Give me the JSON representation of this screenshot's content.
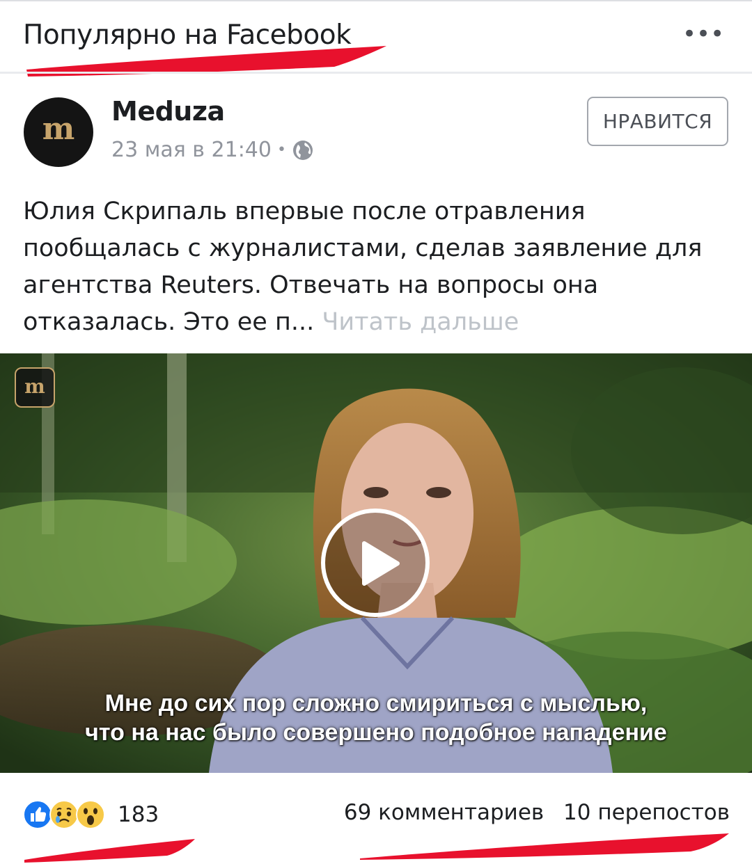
{
  "header": {
    "title": "Популярно на Facebook",
    "more_label": "•••"
  },
  "post": {
    "page_name": "Meduza",
    "avatar_letter": "m",
    "date": "23 мая в 21:40",
    "separator": "•",
    "privacy_icon": "globe-icon",
    "like_button": "НРАВИТСЯ",
    "text": "Юлия Скрипаль впервые после отравления пообщалась с журналистами, сделав заявление для агентства Reuters. Отвечать на вопросы она отказалась. Это ее п...",
    "read_more": "Читать дальше"
  },
  "video": {
    "logo_letter": "m",
    "play_icon": "play-icon",
    "subtitle_line1": "Мне до сих пор сложно смириться с мыслью,",
    "subtitle_line2": "что на нас было совершено подобное нападение"
  },
  "footer": {
    "reaction_icons": [
      "like-reaction-icon",
      "sad-reaction-icon",
      "wow-reaction-icon"
    ],
    "reaction_count": "183",
    "comments": "69 комментариев",
    "shares": "10 перепостов"
  },
  "colors": {
    "highlight": "#e8112d",
    "brand_gold": "#c7a46b",
    "facebook_blue": "#1877f2"
  }
}
